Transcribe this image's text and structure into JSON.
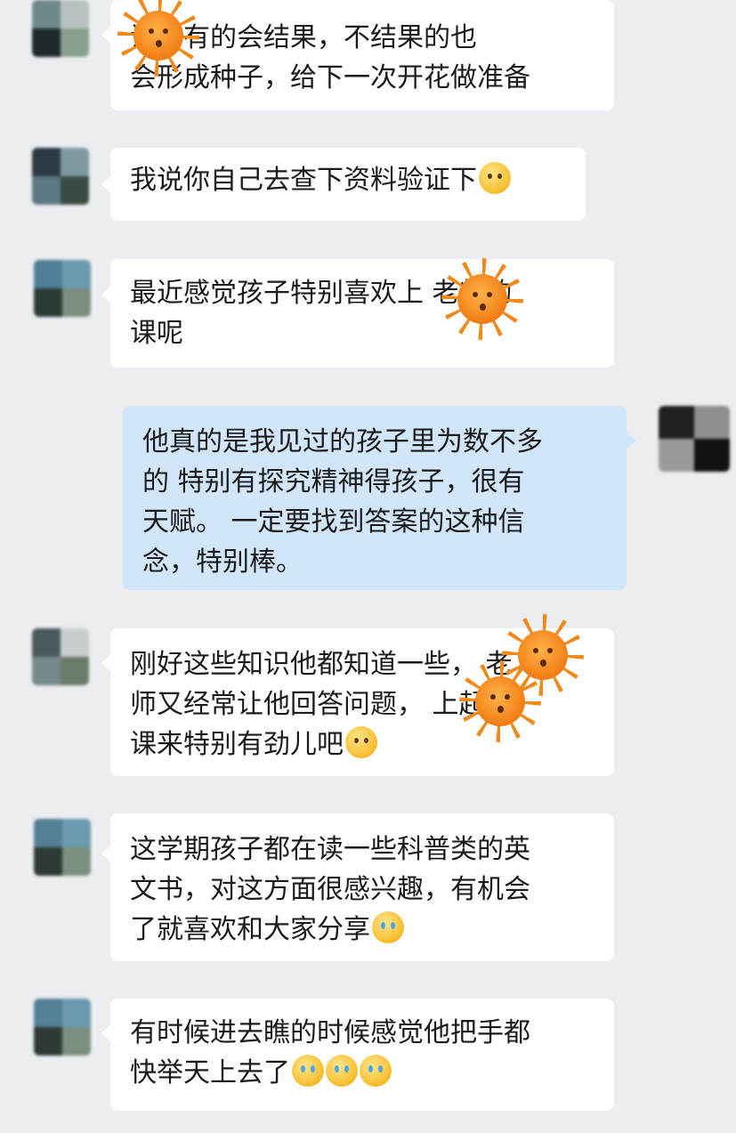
{
  "chat": {
    "messages": [
      {
        "sender": "other",
        "text": "说，有的会结果，不结果的也\n会形成种子，给下一次开花做准备",
        "emojis": []
      },
      {
        "sender": "other",
        "text": "我说你自己去查下资料验证下",
        "emojis": [
          "grin-face"
        ]
      },
      {
        "sender": "other",
        "text": "最近感觉孩子特别喜欢上 老师的\n课呢",
        "emojis": []
      },
      {
        "sender": "me",
        "text": "他真的是我见过的孩子里为数不多\n的 特别有探究精神得孩子，很有\n天赋。 一定要找到答案的这种信\n念，特别棒。",
        "emojis": []
      },
      {
        "sender": "other",
        "text": "刚好这些知识他都知道一些， 老\n师又经常让他回答问题， 上起\n课来特别有劲儿吧",
        "emojis": [
          "grin-face"
        ]
      },
      {
        "sender": "other",
        "text": "这学期孩子都在读一些科普类的英\n文书，对这方面很感兴趣，有机会\n了就喜欢和大家分享",
        "emojis": [
          "laugh-cry-face"
        ]
      },
      {
        "sender": "other",
        "text": "有时候进去瞧的时候感觉他把手都\n快举天上去了",
        "emojis": [
          "laugh-cry-face",
          "laugh-cry-face",
          "laugh-cry-face"
        ]
      }
    ]
  },
  "colors": {
    "background": "#ecedf1",
    "bubble_other": "#ffffff",
    "bubble_me": "#d2e6fb",
    "sticker_sun": "#f07a10"
  },
  "icons": {
    "sticker": "sun-sticker-icon",
    "grin": "grin-face-icon",
    "laugh_cry": "laugh-cry-face-icon"
  }
}
